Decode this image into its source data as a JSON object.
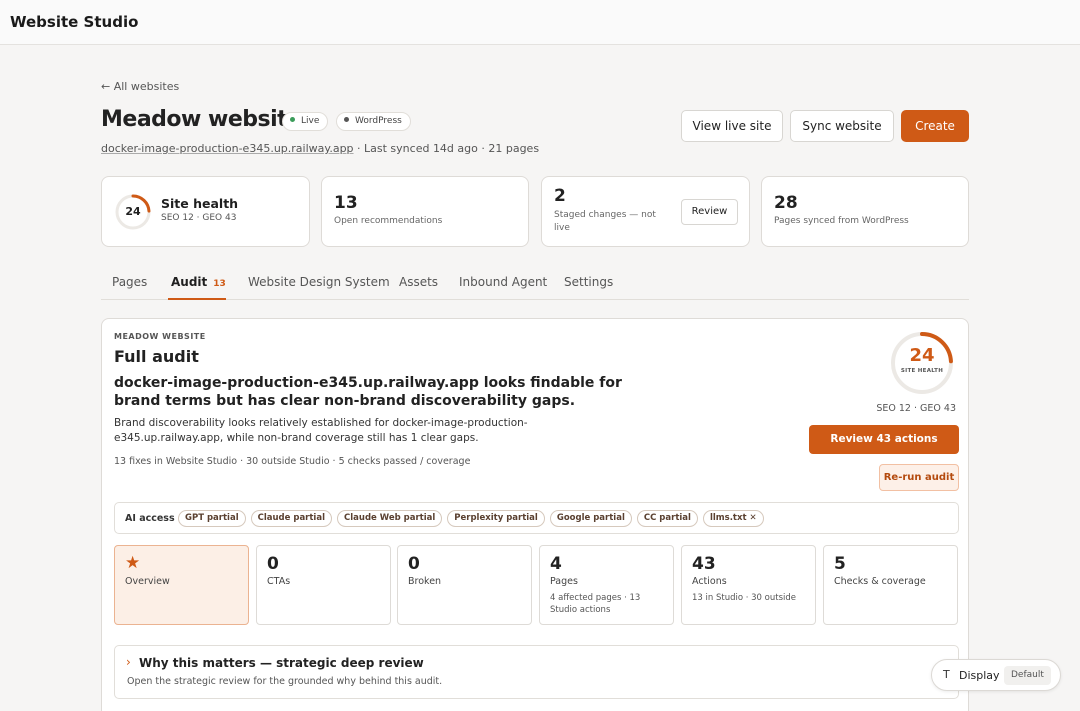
{
  "app": {
    "title": "Website Studio"
  },
  "header": {
    "back_link": "← All websites",
    "site_name": "Meadow website",
    "status_badge": "Live",
    "platform_badge": "WordPress",
    "url": "docker-image-production-e345.up.railway.app",
    "sync_meta": " · Last synced 14d ago · 21 pages",
    "view_live_label": "View live site",
    "sync_label": "Sync website",
    "create_label": "Create",
    "status_color": "#3b9c5a",
    "platform_color": "#555555",
    "accent": "#cf5a16"
  },
  "stats": {
    "health": {
      "score": "24",
      "score_value": 24,
      "label": "Site health",
      "sub": "SEO 12 · GEO 43"
    },
    "recommendations": {
      "count": "13",
      "label": "Open recommendations"
    },
    "staged": {
      "count": "2",
      "label": "Staged changes — not live",
      "button": "Review"
    },
    "synced": {
      "count": "28",
      "label": "Pages synced from WordPress"
    }
  },
  "tabs": [
    {
      "label": "Pages"
    },
    {
      "label": "Audit",
      "count": "13"
    },
    {
      "label": "Website Design System"
    },
    {
      "label": "Assets"
    },
    {
      "label": "Inbound Agent"
    },
    {
      "label": "Settings"
    }
  ],
  "audit": {
    "kicker": "MEADOW WEBSITE",
    "title": "Full audit",
    "headline": "docker-image-production-e345.up.railway.app looks findable for brand terms but has clear non-brand discoverability gaps.",
    "summary": "Brand discoverability looks relatively established for docker-image-production-e345.up.railway.app, while non-brand coverage still has 1 clear gaps.",
    "fine_print": "13 fixes in Website Studio · 30 outside Studio · 5 checks passed / coverage",
    "score": "24",
    "score_value": 24,
    "score_label": "SITE HEALTH",
    "score_meta": "SEO 12 · GEO 43",
    "review_button": "Review 43 actions",
    "rerun_button": "Re-run audit",
    "ai_access_label": "AI access",
    "ai_chips": [
      "GPT partial",
      "Claude partial",
      "Claude Web partial",
      "Perplexity partial",
      "Google partial",
      "CC partial",
      "llms.txt ✕"
    ],
    "metrics": [
      {
        "num": "",
        "label": "Overview",
        "detail": "",
        "icon": "star-icon"
      },
      {
        "num": "0",
        "label": "CTAs",
        "detail": ""
      },
      {
        "num": "0",
        "label": "Broken",
        "detail": ""
      },
      {
        "num": "4",
        "label": "Pages",
        "detail": "4 affected pages · 13 Studio actions"
      },
      {
        "num": "43",
        "label": "Actions",
        "detail": "13 in Studio · 30 outside"
      },
      {
        "num": "5",
        "label": "Checks & coverage",
        "detail": ""
      }
    ],
    "why_title": "Why this matters — strategic deep review",
    "why_desc": "Open the strategic review for the grounded why behind this audit."
  },
  "display_widget": {
    "icon": "T",
    "label": "Display",
    "value": "Default"
  }
}
